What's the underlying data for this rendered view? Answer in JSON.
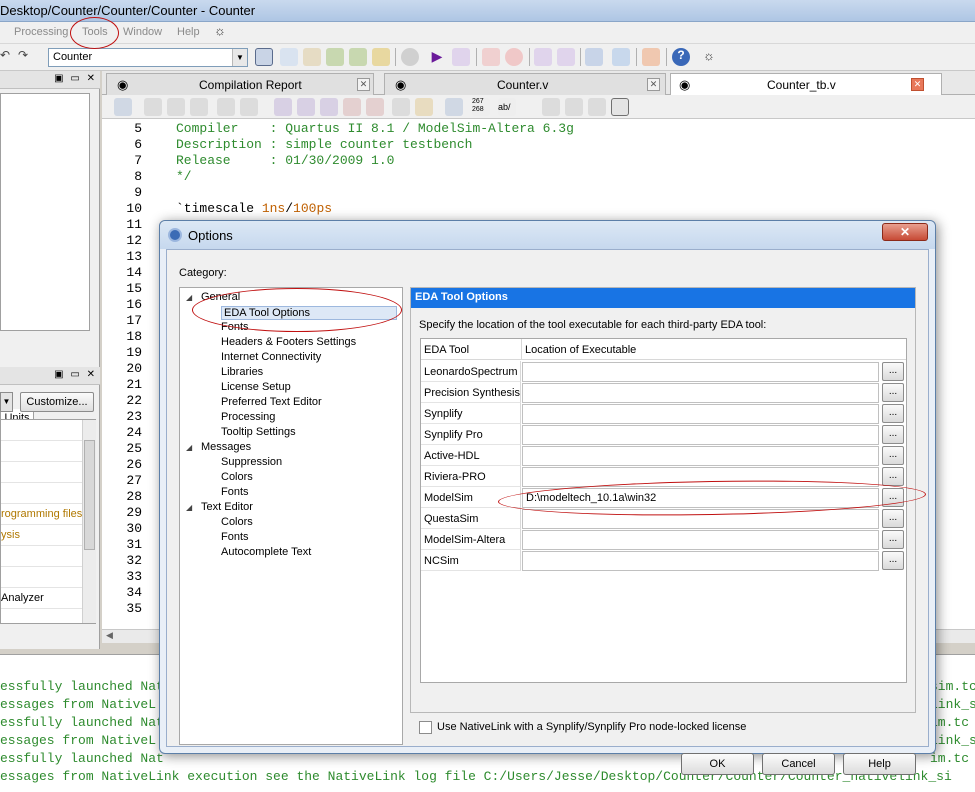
{
  "window": {
    "title": "Desktop/Counter/Counter/Counter - Counter"
  },
  "menu": [
    "Processing",
    "Tools",
    "Window",
    "Help"
  ],
  "toolbar": {
    "project": "Counter"
  },
  "colors": {
    "accent": "#1874e4",
    "code_comment": "#2e8b2e",
    "code_literal": "#c06000",
    "annotation": "#c01010"
  },
  "left_panel": {
    "units_tab": "Units",
    "customize_button": "Customize...",
    "tasks": [
      "",
      "",
      "",
      "",
      "rogramming files",
      "ysis",
      "",
      "",
      "Analyzer"
    ]
  },
  "tabs": [
    {
      "label": "Compilation Report",
      "icon": "report-icon"
    },
    {
      "label": "Counter.v",
      "icon": "verilog-file-icon"
    },
    {
      "label": "Counter_tb.v",
      "icon": "verilog-file-icon"
    }
  ],
  "editor": {
    "lines": [
      {
        "n": "5",
        "parts": [
          {
            "t": "Compiler    : Quartus II 8.1 / ModelSim-Altera 6.3g",
            "c": "c-green"
          }
        ]
      },
      {
        "n": "6",
        "parts": [
          {
            "t": "Description : simple counter testbench",
            "c": "c-green"
          }
        ]
      },
      {
        "n": "7",
        "parts": [
          {
            "t": "Release     : 01/30/2009 1.0",
            "c": "c-green"
          }
        ]
      },
      {
        "n": "8",
        "parts": [
          {
            "t": "*/",
            "c": "c-green"
          }
        ]
      },
      {
        "n": "9",
        "parts": []
      },
      {
        "n": "10",
        "parts": [
          {
            "t": "`timescale ",
            "c": "c-dark"
          },
          {
            "t": "1ns",
            "c": "c-orange"
          },
          {
            "t": "/",
            "c": "c-dark"
          },
          {
            "t": "100ps",
            "c": "c-orange"
          }
        ]
      },
      {
        "n": "11",
        "parts": []
      },
      {
        "n": "12",
        "parts": []
      },
      {
        "n": "13",
        "parts": []
      },
      {
        "n": "14",
        "parts": []
      },
      {
        "n": "15",
        "parts": []
      },
      {
        "n": "16",
        "parts": []
      },
      {
        "n": "17",
        "parts": []
      },
      {
        "n": "18",
        "parts": []
      },
      {
        "n": "19",
        "parts": []
      },
      {
        "n": "20",
        "parts": []
      },
      {
        "n": "21",
        "parts": []
      },
      {
        "n": "22",
        "parts": []
      },
      {
        "n": "23",
        "parts": []
      },
      {
        "n": "24",
        "parts": []
      },
      {
        "n": "25",
        "parts": []
      },
      {
        "n": "26",
        "parts": []
      },
      {
        "n": "27",
        "parts": []
      },
      {
        "n": "28",
        "parts": []
      },
      {
        "n": "29",
        "parts": []
      },
      {
        "n": "30",
        "parts": []
      },
      {
        "n": "31",
        "parts": []
      },
      {
        "n": "32",
        "parts": []
      },
      {
        "n": "33",
        "parts": []
      },
      {
        "n": "34",
        "parts": []
      },
      {
        "n": "35",
        "parts": []
      }
    ]
  },
  "console": [
    "essfully launched Nat",
    "essages from NativeL",
    "essfully launched Nat",
    "essages from NativeL",
    "essfully launched Nat",
    "essages from NativeLink execution see the NativeLink log file C:/Users/Jesse/Desktop/Counter/Counter/Counter_nativelink_si"
  ],
  "console_right": [
    "sim.tc",
    "link_si",
    "im.tc",
    "link_si",
    "im.tc"
  ],
  "dialog": {
    "title": "Options",
    "category_label": "Category:",
    "tree": [
      {
        "label": "General",
        "level": 0,
        "expanded": true
      },
      {
        "label": "EDA Tool Options",
        "level": 1,
        "selected": true
      },
      {
        "label": "Fonts",
        "level": 1
      },
      {
        "label": "Headers & Footers Settings",
        "level": 1
      },
      {
        "label": "Internet Connectivity",
        "level": 1
      },
      {
        "label": "Libraries",
        "level": 1
      },
      {
        "label": "License Setup",
        "level": 1
      },
      {
        "label": "Preferred Text Editor",
        "level": 1
      },
      {
        "label": "Processing",
        "level": 1
      },
      {
        "label": "Tooltip Settings",
        "level": 1
      },
      {
        "label": "Messages",
        "level": 0,
        "expanded": true
      },
      {
        "label": "Suppression",
        "level": 1
      },
      {
        "label": "Colors",
        "level": 1
      },
      {
        "label": "Fonts",
        "level": 1
      },
      {
        "label": "Text Editor",
        "level": 0,
        "expanded": true
      },
      {
        "label": "Colors",
        "level": 1
      },
      {
        "label": "Fonts",
        "level": 1
      },
      {
        "label": "Autocomplete Text",
        "level": 1
      }
    ],
    "pane_title": "EDA Tool Options",
    "pane_desc": "Specify the location of the tool executable for each third-party EDA tool:",
    "columns": [
      "EDA Tool",
      "Location of Executable"
    ],
    "rows": [
      {
        "tool": "LeonardoSpectrum",
        "path": ""
      },
      {
        "tool": "Precision Synthesis",
        "path": ""
      },
      {
        "tool": "Synplify",
        "path": ""
      },
      {
        "tool": "Synplify Pro",
        "path": ""
      },
      {
        "tool": "Active-HDL",
        "path": ""
      },
      {
        "tool": "Riviera-PRO",
        "path": ""
      },
      {
        "tool": "ModelSim",
        "path": "D:\\modeltech_10.1a\\win32"
      },
      {
        "tool": "QuestaSim",
        "path": ""
      },
      {
        "tool": "ModelSim-Altera",
        "path": ""
      },
      {
        "tool": "NCSim",
        "path": ""
      }
    ],
    "browse_label": "...",
    "checkbox_label": "Use NativeLink with a Synplify/Synplify Pro node-locked license",
    "buttons": {
      "ok": "OK",
      "cancel": "Cancel",
      "help": "Help"
    }
  }
}
